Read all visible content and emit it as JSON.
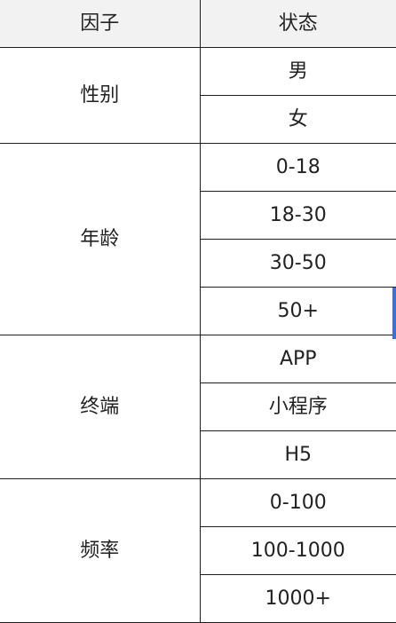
{
  "table": {
    "headers": [
      "因子",
      "状态"
    ],
    "groups": [
      {
        "factor": "性别",
        "states": [
          "男",
          "女"
        ]
      },
      {
        "factor": "年龄",
        "states": [
          "0-18",
          "18-30",
          "30-50",
          "50+"
        ]
      },
      {
        "factor": "终端",
        "states": [
          "APP",
          "小程序",
          "H5"
        ]
      },
      {
        "factor": "频率",
        "states": [
          "0-100",
          "100-1000",
          "1000+"
        ]
      }
    ]
  },
  "colors": {
    "header_background": "#f2f2f2",
    "border": "#1e1e1e",
    "indicator": "#3b6fe0"
  }
}
